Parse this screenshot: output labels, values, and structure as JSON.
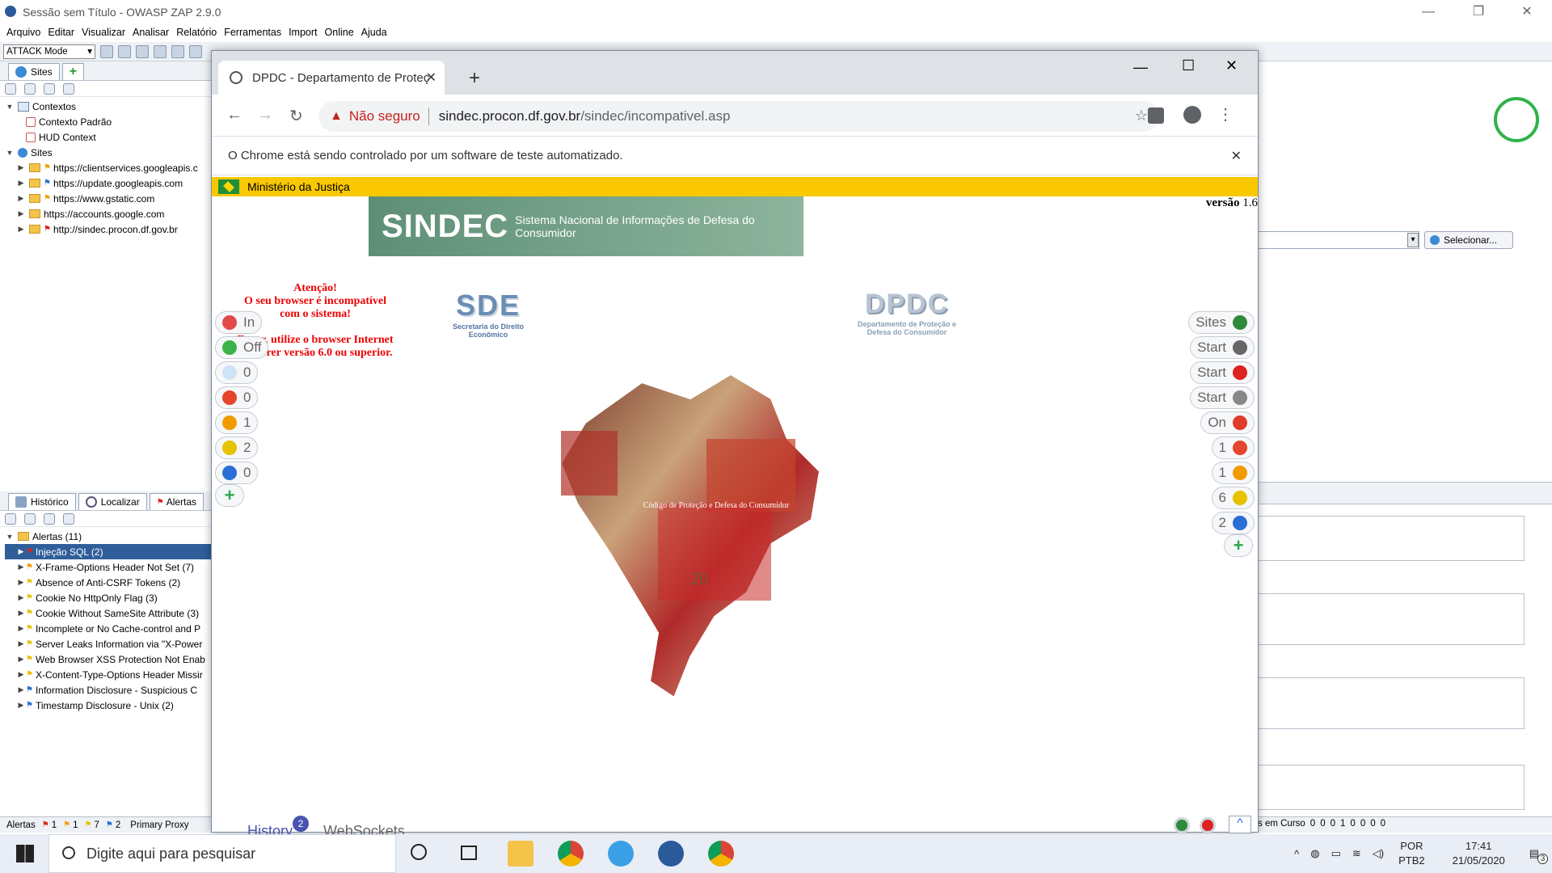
{
  "zap": {
    "title": "Sessão sem Título - OWASP ZAP 2.9.0",
    "menu": [
      "Arquivo",
      "Editar",
      "Visualizar",
      "Analisar",
      "Relatório",
      "Ferramentas",
      "Import",
      "Online",
      "Ajuda"
    ],
    "mode": "ATTACK Mode",
    "sites_tab": "Sites",
    "tree": {
      "contexts": "Contextos",
      "ctx_default": "Contexto Padrão",
      "ctx_hud": "HUD Context",
      "sites": "Sites",
      "site_list": [
        "https://clientservices.googleapis.c",
        "https://update.googleapis.com",
        "https://www.gstatic.com",
        "https://accounts.google.com",
        "http://sindec.procon.df.gov.br"
      ]
    },
    "bottom_tabs": [
      "Histórico",
      "Localizar",
      "Alertas"
    ],
    "alerts_root": "Alertas (11)",
    "alerts": [
      {
        "label": "Injeção SQL (2)",
        "flag": "red"
      },
      {
        "label": "X-Frame-Options Header Not Set (7)",
        "flag": "orange"
      },
      {
        "label": "Absence of Anti-CSRF Tokens (2)",
        "flag": "yellow"
      },
      {
        "label": "Cookie No HttpOnly Flag (3)",
        "flag": "yellow"
      },
      {
        "label": "Cookie Without SameSite Attribute (3)",
        "flag": "yellow"
      },
      {
        "label": "Incomplete or No Cache-control and P",
        "flag": "yellow"
      },
      {
        "label": "Server Leaks Information via \"X-Power",
        "flag": "yellow"
      },
      {
        "label": "Web Browser XSS Protection Not Enab",
        "flag": "yellow"
      },
      {
        "label": "X-Content-Type-Options Header Missir",
        "flag": "yellow"
      },
      {
        "label": "Information Disclosure - Suspicious C",
        "flag": "blue"
      },
      {
        "label": "Timestamp Disclosure - Unix (2)",
        "flag": "blue"
      }
    ],
    "status_left": "Alertas",
    "status_counts": [
      "1",
      "1",
      "7",
      "2"
    ],
    "status_proxy": "Primary Proxy",
    "status_right": "s em Curso",
    "status_right_counts": [
      "0",
      "0",
      "0",
      "1",
      "0",
      "0",
      "0",
      "0"
    ],
    "select_button": "Selecionar..."
  },
  "chrome": {
    "tab_title": "DPDC - Departamento de Proteç",
    "not_secure": "Não seguro",
    "url_host": "sindec.procon.df.gov.br",
    "url_path": "/sindec/incompativel.asp",
    "infobar": "O Chrome está sendo controlado por um software de teste automatizado."
  },
  "page": {
    "ministry": "Ministério da Justiça",
    "sindec_big": "SINDEC",
    "sindec_small": "Sistema Nacional de Informações de Defesa do Consumidor",
    "versao_label": "versão",
    "versao_num": "1.6",
    "warning_lines": [
      "Atenção!",
      "O seu browser é incompatível",
      "com o sistema!"
    ],
    "warning_lines2": [
      "Favor, utilize o browser Internet",
      "Explorer versão 6.0 ou superior."
    ],
    "sde": "SDE",
    "sde_sub": "Secretaria do Direito Econômico",
    "dpdc": "DPDC",
    "dpdc_sub": "Departamento de Proteção e Defesa do Consumidor",
    "codigo": "Código de Proteção e Defesa do Consumidor"
  },
  "hud": {
    "left": [
      {
        "label": "In",
        "color": "#e24a4a"
      },
      {
        "label": "Off",
        "color": "#3cb34a"
      },
      {
        "label": "0",
        "color": "#cfe3f7"
      },
      {
        "label": "0",
        "color": "#e5452c"
      },
      {
        "label": "1",
        "color": "#f29b00"
      },
      {
        "label": "2",
        "color": "#e6c200"
      },
      {
        "label": "0",
        "color": "#2a6ed6"
      }
    ],
    "right": [
      {
        "label": "Sites",
        "color": "#2f8a3c"
      },
      {
        "label": "Start",
        "color": "#666"
      },
      {
        "label": "Start",
        "color": "#d22"
      },
      {
        "label": "Start",
        "color": "#888"
      },
      {
        "label": "On",
        "color": "#e03b2c"
      },
      {
        "label": "1",
        "color": "#e5452c"
      },
      {
        "label": "1",
        "color": "#f29b00"
      },
      {
        "label": "6",
        "color": "#e6c200"
      },
      {
        "label": "2",
        "color": "#2a6ed6"
      }
    ],
    "bottom_history": "History",
    "bottom_badge": "2",
    "bottom_ws": "WebSockets"
  },
  "taskbar": {
    "search_placeholder": "Digite aqui para pesquisar",
    "lang1": "POR",
    "lang2": "PTB2",
    "time": "17:41",
    "date": "21/05/2020",
    "notif": "3"
  }
}
